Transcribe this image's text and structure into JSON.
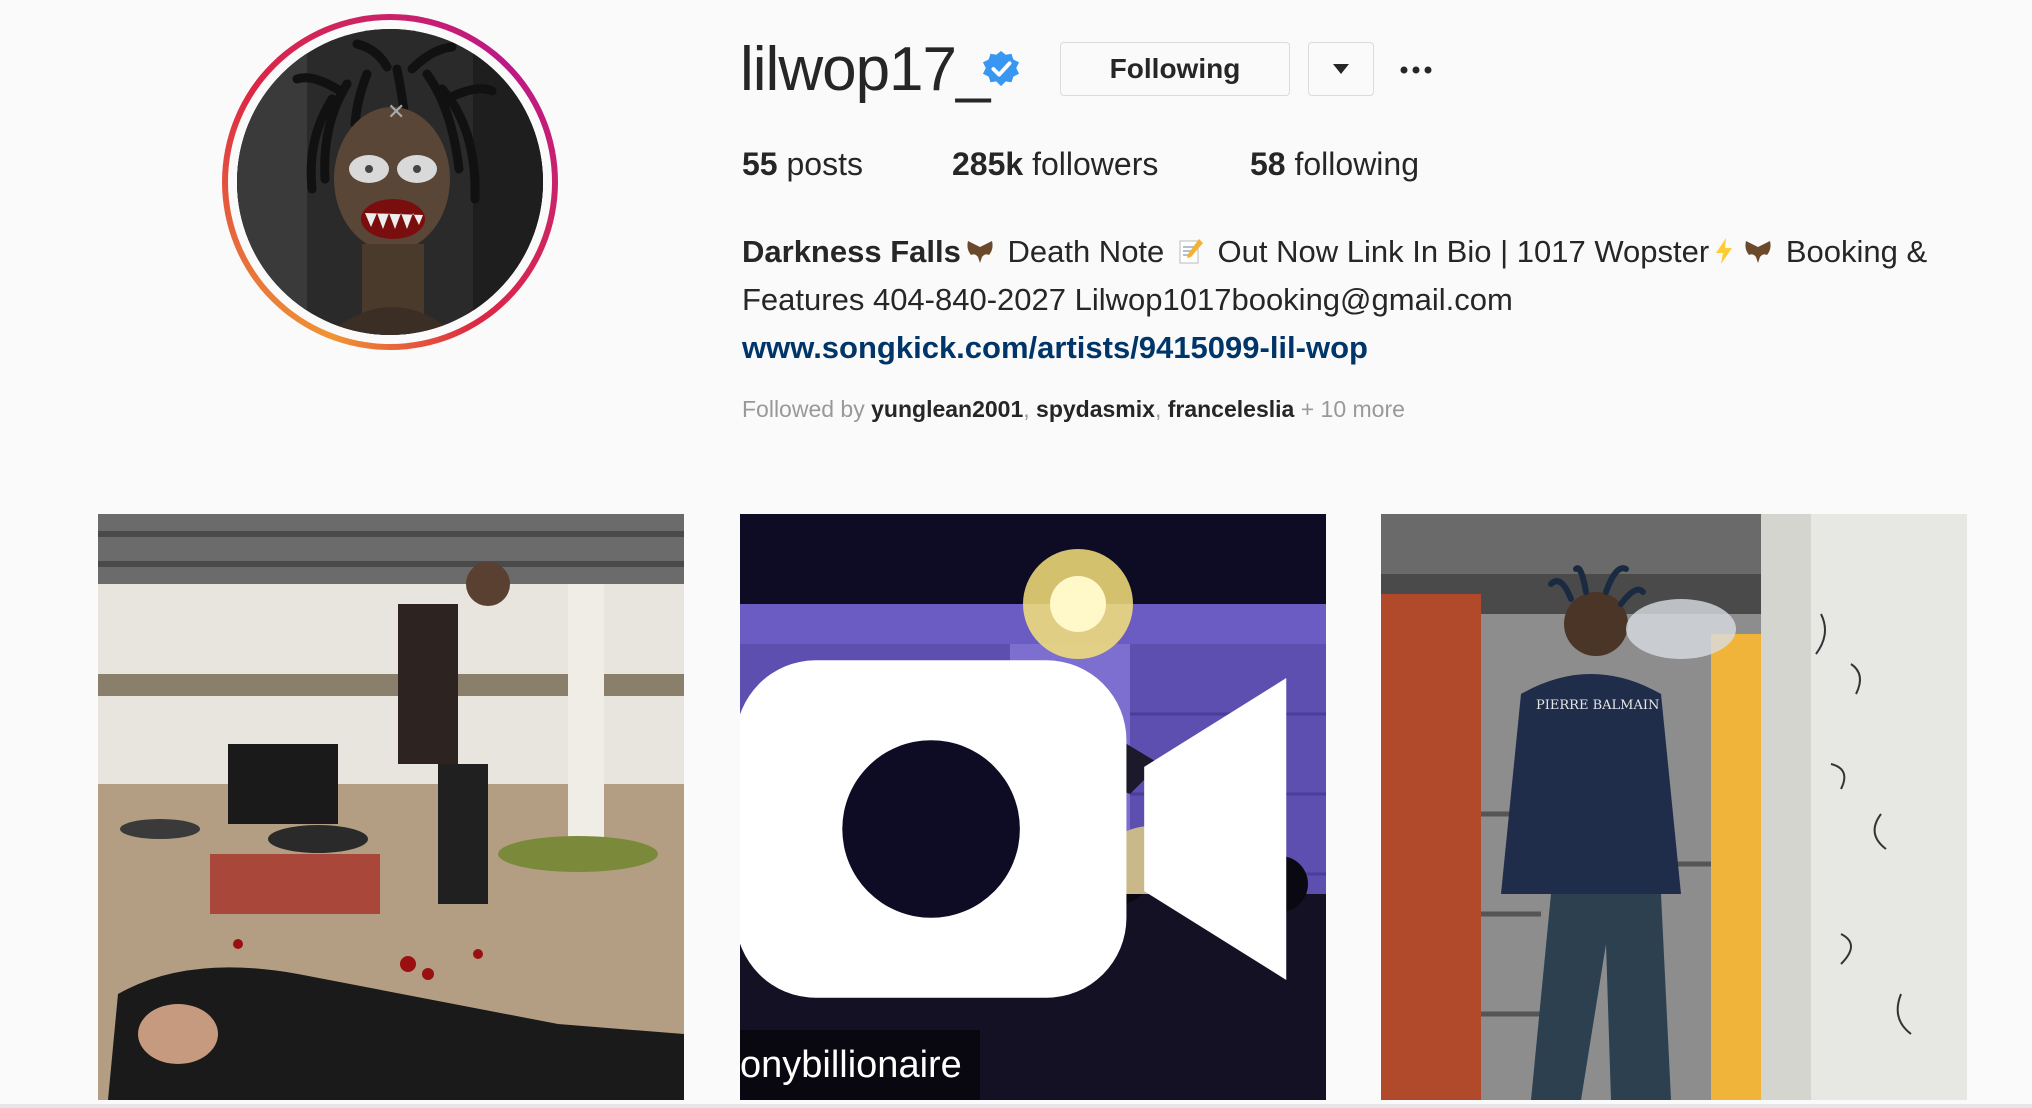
{
  "profile": {
    "username": "lilwop17_",
    "follow_button": "Following",
    "stats": {
      "posts_count": "55",
      "posts_label": " posts",
      "followers_count": "285k",
      "followers_label": " followers",
      "following_count": "58",
      "following_label": " following"
    },
    "bio": {
      "name": "Darkness Falls",
      "part1": " Death Note ",
      "part2": " Out Now Link In Bio | 1017 Wopster",
      "part3": " Booking & Features 404-840-2027 Lilwop1017booking@gmail.com",
      "link": "www.songkick.com/artists/9415099-lil-wop"
    },
    "followed_by": {
      "prefix": "Followed by ",
      "users": [
        "yunglean2001",
        "spydasmix",
        "franceleslia"
      ],
      "suffix": " + 10 more"
    }
  },
  "posts": [
    {
      "type": "photo"
    },
    {
      "type": "video",
      "watermark": "onybillionaire"
    },
    {
      "type": "photo",
      "shirt_text": "PIERRE BALMAIN"
    }
  ],
  "colors": {
    "background": "#fafafa",
    "text": "#262626",
    "link": "#003569",
    "muted": "#999999",
    "verified": "#3897f0"
  },
  "icons": {
    "verified": "verified-badge-icon",
    "dropdown": "caret-down-icon",
    "more": "more-options-icon",
    "video": "video-camera-icon"
  }
}
